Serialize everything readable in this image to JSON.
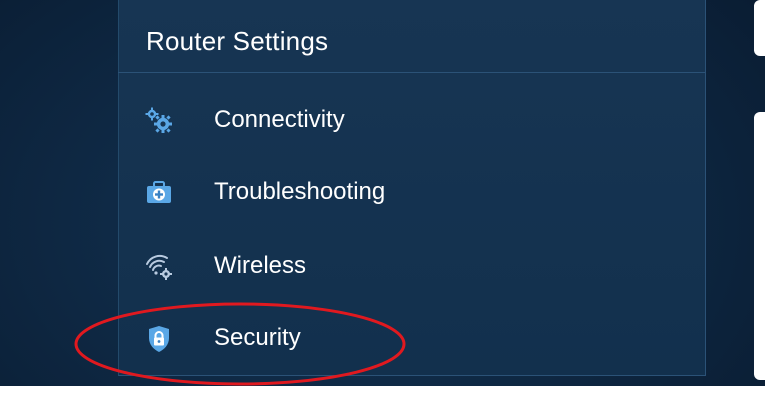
{
  "panel": {
    "title": "Router Settings"
  },
  "menu": {
    "items": [
      {
        "label": "Connectivity",
        "icon": "gears-icon"
      },
      {
        "label": "Troubleshooting",
        "icon": "medical-kit-icon"
      },
      {
        "label": "Wireless",
        "icon": "wifi-gear-icon"
      },
      {
        "label": "Security",
        "icon": "shield-lock-icon"
      }
    ]
  },
  "colors": {
    "background": "#0e2238",
    "panel": "#173553",
    "icon_blue": "#5aa7e6",
    "highlight": "#e0191f"
  }
}
